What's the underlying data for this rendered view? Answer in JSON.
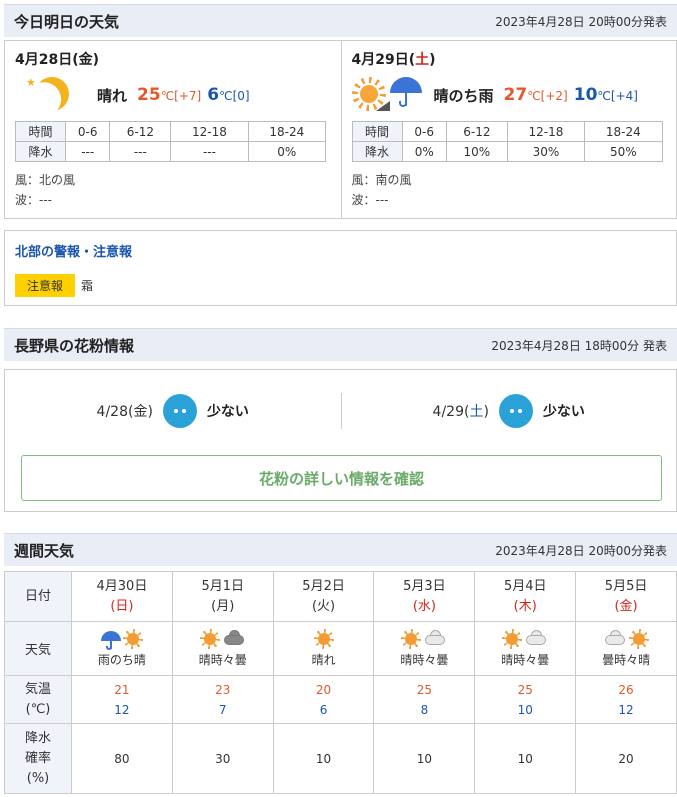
{
  "today_section": {
    "title": "今日明日の天気",
    "issued": "2023年4月28日 20時00分発表",
    "days": [
      {
        "date": "4月28日",
        "dow_open": "(",
        "dow": "金",
        "dow_close": ")",
        "icon": "moon-icon",
        "weather": "晴れ",
        "high": "25",
        "high_unit": "℃",
        "high_diff": "[+7]",
        "low": "6",
        "low_unit": "℃",
        "low_diff": "[0]",
        "rain_header": [
          "時間",
          "0-6",
          "6-12",
          "12-18",
          "18-24"
        ],
        "rain_values": [
          "降水",
          "---",
          "---",
          "---",
          "0%"
        ],
        "wind": "風：北の風",
        "wave": "波：---"
      },
      {
        "date": "4月29日",
        "dow_open": "(",
        "dow": "土",
        "dow_close": ")",
        "icon": "sun-then-rain-icon",
        "weather": "晴のち雨",
        "high": "27",
        "high_unit": "℃",
        "high_diff": "[+2]",
        "low": "10",
        "low_unit": "℃",
        "low_diff": "[+4]",
        "rain_header": [
          "時間",
          "0-6",
          "6-12",
          "12-18",
          "18-24"
        ],
        "rain_values": [
          "降水",
          "0%",
          "10%",
          "30%",
          "50%"
        ],
        "wind": "風：南の風",
        "wave": "波：---"
      }
    ]
  },
  "warnings": {
    "title": "北部の警報・注意報",
    "badge": "注意報",
    "item": "霜"
  },
  "pollen": {
    "title": "長野県の花粉情報",
    "issued": "2023年4月28日 18時00分 発表",
    "days": [
      {
        "date": "4/28",
        "dow_open": "(",
        "dow": "金",
        "dow_close": ")",
        "level": "少ない"
      },
      {
        "date": "4/29",
        "dow_open": "(",
        "dow": "土",
        "dow_close": ")",
        "level": "少ない"
      }
    ],
    "button": "花粉の詳しい情報を確認"
  },
  "weekly": {
    "title": "週間天気",
    "issued": "2023年4月28日 20時00分発表",
    "row_labels": {
      "date": "日付",
      "weather": "天気",
      "temp_line1": "気温",
      "temp_line2": "(℃)",
      "pop_line1": "降水",
      "pop_line2": "確率",
      "pop_line3": "(%)"
    },
    "days": [
      {
        "date": "4月30日",
        "dow": "(日)",
        "weather": "雨のち晴",
        "icons": [
          "umbrella-icon",
          "sun-icon"
        ],
        "high": "21",
        "low": "12",
        "pop": "80"
      },
      {
        "date": "5月1日",
        "dow": "(月)",
        "weather": "晴時々曇",
        "icons": [
          "sun-icon",
          "cloud-icon"
        ],
        "high": "23",
        "low": "7",
        "pop": "30"
      },
      {
        "date": "5月2日",
        "dow": "(火)",
        "weather": "晴れ",
        "icons": [
          "sun-icon"
        ],
        "high": "20",
        "low": "6",
        "pop": "10"
      },
      {
        "date": "5月3日",
        "dow": "(水)",
        "weather": "晴時々曇",
        "icons": [
          "sun-icon",
          "cloud-icon"
        ],
        "high": "25",
        "low": "8",
        "pop": "10"
      },
      {
        "date": "5月4日",
        "dow": "(木)",
        "weather": "晴時々曇",
        "icons": [
          "sun-icon",
          "cloud-icon"
        ],
        "high": "25",
        "low": "10",
        "pop": "10"
      },
      {
        "date": "5月5日",
        "dow": "(金)",
        "weather": "曇時々晴",
        "icons": [
          "cloud-icon",
          "sun-icon"
        ],
        "high": "26",
        "low": "12",
        "pop": "20"
      }
    ]
  },
  "colors": {
    "high_temp": "#e05a2a",
    "low_temp": "#1a56b0",
    "saturday": "#1a56b0",
    "sunday_holiday": "#d6241b",
    "warning_badge": "#ffd000",
    "pollen_low": "#2aa2d8"
  }
}
